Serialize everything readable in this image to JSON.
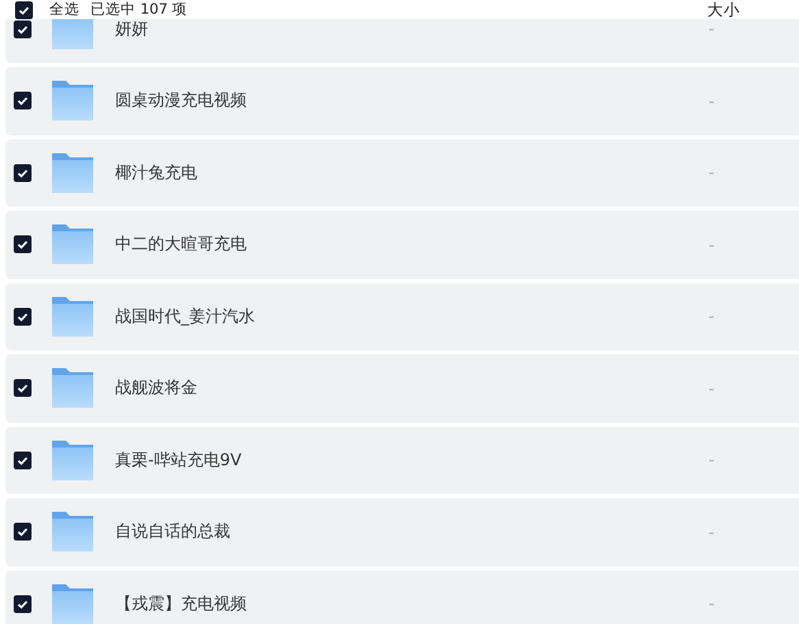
{
  "header": {
    "select_all": {
      "label": "全选",
      "checked": true
    },
    "selection_count": "已选中 107 项",
    "size_column": "大小"
  },
  "rows": [
    {
      "name": "妍妍",
      "size": "-",
      "checked": true
    },
    {
      "name": "圆桌动漫充电视频",
      "size": "-",
      "checked": true
    },
    {
      "name": "椰汁兔充电",
      "size": "-",
      "checked": true
    },
    {
      "name": "中二的大暄哥充电",
      "size": "-",
      "checked": true
    },
    {
      "name": "战国时代_姜汁汽水",
      "size": "-",
      "checked": true
    },
    {
      "name": "战舰波将金",
      "size": "-",
      "checked": true
    },
    {
      "name": "真栗-哔站充电9V",
      "size": "-",
      "checked": true
    },
    {
      "name": "自说自话的总裁",
      "size": "-",
      "checked": true
    },
    {
      "name": "【戎震】充电视频",
      "size": "-",
      "checked": true
    }
  ]
}
